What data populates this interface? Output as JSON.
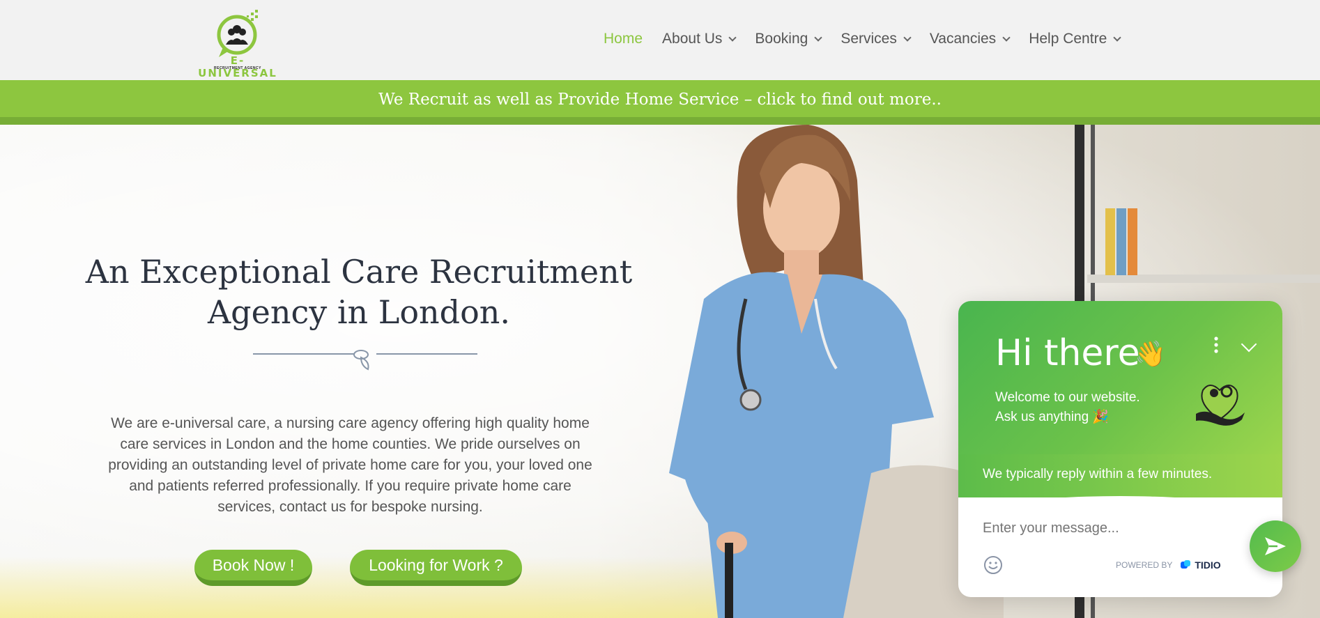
{
  "brand": {
    "logo_text": "E-UNIVERSAL",
    "logo_subtext": "RECRUITMENT AGENCY",
    "accent_color": "#8dc63f"
  },
  "nav": {
    "items": [
      {
        "label": "Home",
        "active": true,
        "has_dropdown": false
      },
      {
        "label": "About Us",
        "active": false,
        "has_dropdown": true
      },
      {
        "label": "Booking",
        "active": false,
        "has_dropdown": true
      },
      {
        "label": "Services",
        "active": false,
        "has_dropdown": true
      },
      {
        "label": "Vacancies",
        "active": false,
        "has_dropdown": true
      },
      {
        "label": "Help Centre",
        "active": false,
        "has_dropdown": true
      }
    ]
  },
  "banner": {
    "text": "We Recruit as well as Provide Home Service – click to find out more.."
  },
  "hero": {
    "title": "An Exceptional Care Recruitment Agency in London.",
    "description": "We are e-universal care, a nursing care agency offering high quality home care services in London and the home counties. We pride ourselves on providing an outstanding level of private home care for you, your loved one and patients referred professionally. If you require private home care services, contact us for bespoke nursing.",
    "buttons": {
      "book": "Book Now !",
      "work": "Looking for Work ?"
    }
  },
  "chat": {
    "greeting": "Hi there",
    "wave_emoji": "👋",
    "welcome_line1": "Welcome to our website.",
    "welcome_line2": "Ask us anything",
    "party_emoji": "🎉",
    "reply_time": "We typically reply within a few minutes.",
    "input_placeholder": "Enter your message...",
    "powered_by": "POWERED BY",
    "powered_brand": "TIDIO",
    "icons": [
      "more-options-icon",
      "collapse-chevron-icon",
      "emoji-icon",
      "send-icon"
    ]
  }
}
